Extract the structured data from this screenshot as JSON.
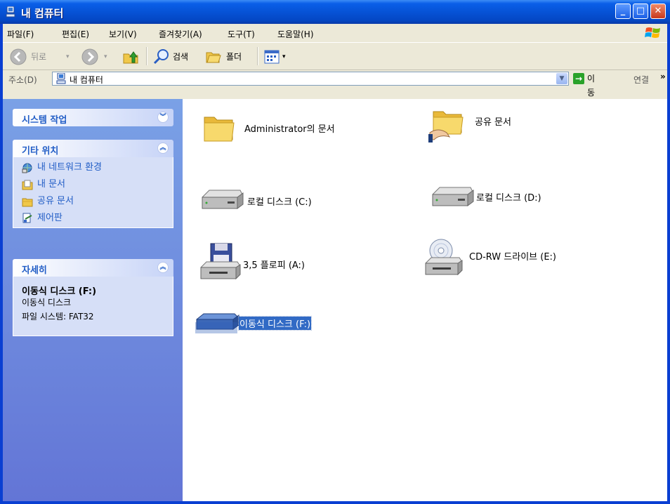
{
  "window": {
    "title": "내 컴퓨터"
  },
  "menubar": {
    "items": [
      "파일(F)",
      "편집(E)",
      "보기(V)",
      "즐겨찾기(A)",
      "도구(T)",
      "도움말(H)"
    ]
  },
  "toolbar": {
    "back": "뒤로",
    "search": "검색",
    "folders": "폴더"
  },
  "address": {
    "label": "주소(D)",
    "value": "내 컴퓨터",
    "go": "이동",
    "links": "연결"
  },
  "sidepanels": {
    "system_tasks": {
      "title": "시스템 작업"
    },
    "other_places": {
      "title": "기타 위치",
      "links": [
        "내 네트워크 환경",
        "내 문서",
        "공유 문서",
        "제어판"
      ]
    },
    "details": {
      "title": "자세히",
      "name": "이동식 디스크 (F:)",
      "type": "이동식 디스크",
      "filesystem": "파일 시스템: FAT32"
    }
  },
  "files": [
    {
      "label": "Administrator의 문서",
      "icon": "folder-icon"
    },
    {
      "label": "공유 문서",
      "icon": "shared-folder-icon"
    },
    {
      "label": "로컬 디스크 (C:)",
      "icon": "hard-disk-icon"
    },
    {
      "label": "로컬 디스크 (D:)",
      "icon": "hard-disk-icon"
    },
    {
      "label": "3,5 플로피 (A:)",
      "icon": "floppy-drive-icon"
    },
    {
      "label": "CD-RW 드라이브 (E:)",
      "icon": "cd-drive-icon"
    },
    {
      "label": "이동식 디스크 (F:)",
      "icon": "removable-disk-icon",
      "selected": true
    }
  ],
  "colors": {
    "title_bar": "#0653d6",
    "left_pane": "#6f8de0",
    "link": "#215dc6",
    "selection": "#316ac5"
  }
}
